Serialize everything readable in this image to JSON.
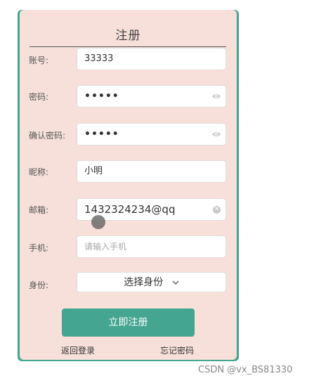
{
  "form": {
    "title": "注册",
    "fields": [
      {
        "label": "账号:",
        "value": "33333"
      },
      {
        "label": "密码:",
        "value": "•••••"
      },
      {
        "label": "确认密码:",
        "value": "•••••"
      },
      {
        "label": "昵称:",
        "value": "小明"
      },
      {
        "label": "邮箱:",
        "value": "1432324234@qq"
      },
      {
        "label": "手机:",
        "placeholder": "请输入手机"
      },
      {
        "label": "身份:",
        "selected": "选择身份"
      }
    ],
    "submit_label": "立即注册",
    "back_login_label": "返回登录",
    "forgot_password_label": "忘记密码"
  },
  "watermark": "CSDN @vx_BS81330",
  "colors": {
    "accent": "#44a590",
    "card_background": "#f6e0d9"
  },
  "icons": {
    "password_toggle": "eye-icon",
    "clear": "clear-icon",
    "select": "chevron-down-icon"
  }
}
